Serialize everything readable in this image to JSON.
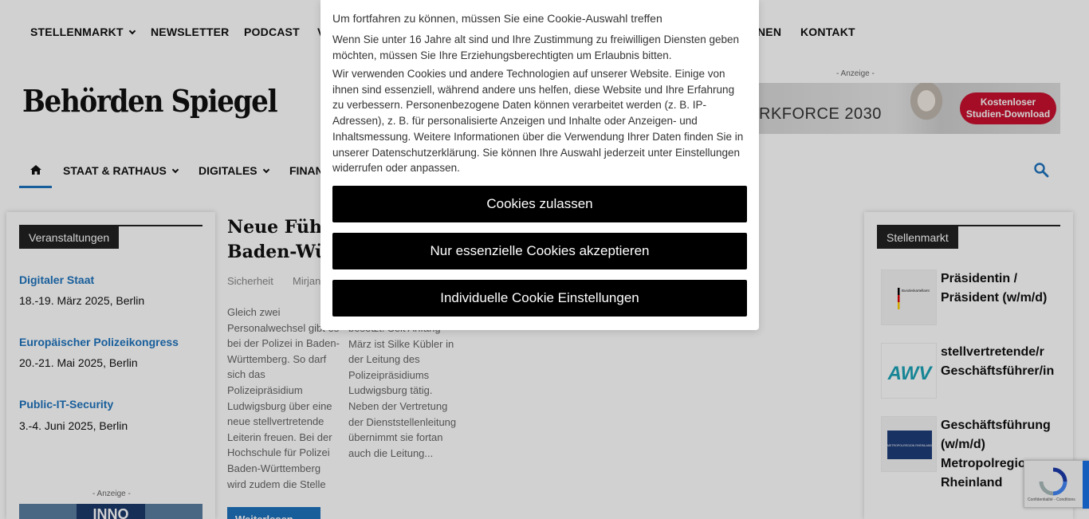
{
  "top_nav": {
    "items": [
      "STELLENMARKT",
      "NEWSLETTER",
      "PODCAST",
      "V",
      "NEN",
      "KONTAKT"
    ]
  },
  "logo": "Behörden Spiegel",
  "ads": {
    "label": "- Anzeige -",
    "banner_text": "RKFORCE 2030",
    "banner_cta_line1": "Kostenloser",
    "banner_cta_line2": "Studien-Download",
    "bottom_ad_text": "INNO"
  },
  "main_nav": {
    "items": [
      "STAAT & RATHAUS",
      "DIGITALES",
      "FINAN"
    ],
    "home_icon": "home-icon",
    "search_icon": "search-icon"
  },
  "events": {
    "heading": "Veranstaltungen",
    "items": [
      {
        "title": "Digitaler Staat",
        "date": "18.-19. März 2025, Berlin"
      },
      {
        "title": "Europäischer Polizeikongress",
        "date": "20.-21. Mai 2025, Berlin"
      },
      {
        "title": "Public-IT-Security",
        "date": "3.-4. Juni 2025, Berlin"
      }
    ]
  },
  "article": {
    "title_line1": "Neue Führ",
    "title_line2": "Baden-Wü",
    "category": "Sicherheit",
    "author": "Mirjan",
    "excerpt_col1": "Gleich zwei Personalwechsel gibt es bei der Polizei in Baden-Württemberg. So darf sich das Polizeipräsidium Ludwigsburg über eine neue stellvertretende Leiterin freuen. Bei der Hochschule für Polizei Baden-Württemberg wird zudem die Stelle",
    "excerpt_col2": "besetzt. Seit Anfang März ist Silke Kübler in der Leitung des Polizeipräsidiums Ludwigsburg tätig. Neben der Vertretung der Dienststellenleitung übernimmt sie fortan auch die Leitung...",
    "read_more": "Weiterlesen"
  },
  "jobs": {
    "heading": "Stellenmarkt",
    "items": [
      {
        "title": "Präsidentin / Präsident (w/m/d)",
        "logo": "bundesadler-logo",
        "logo_text": "Bundeskartellamt"
      },
      {
        "title": "stellvertretende/r Geschäftsführer/in",
        "logo": "awv-logo",
        "logo_text": "AWV"
      },
      {
        "title": "Geschäftsführung (w/m/d) Metropolregion Rheinland",
        "logo": "metropolregion-logo",
        "logo_text": "METROPOLREGION RHEINLAND"
      }
    ]
  },
  "recaptcha": {
    "text": "Confidentialité - Conditions"
  },
  "cookie_modal": {
    "heading": "Um fortfahren zu können, müssen Sie eine Cookie-Auswahl treffen",
    "paragraph1": "Wenn Sie unter 16 Jahre alt sind und Ihre Zustimmung zu freiwilligen Diensten geben möchten, müssen Sie Ihre Erziehungsberechtigten um Erlaubnis bitten.",
    "paragraph2": "Wir verwenden Cookies und andere Technologien auf unserer Website. Einige von ihnen sind essenziell, während andere uns helfen, diese Website und Ihre Erfahrung zu verbessern. Personenbezogene Daten können verarbeitet werden (z. B. IP-Adressen), z. B. für personalisierte Anzeigen und Inhalte oder Anzeigen- und Inhaltsmessung. Weitere Informationen über die Verwendung Ihrer Daten finden Sie in unserer Datenschutzerklärung. Sie können Ihre Auswahl jederzeit unter Einstellungen widerrufen oder anpassen.",
    "btn_accept_all": "Cookies zulassen",
    "btn_essential": "Nur essenzielle Cookies akzeptieren",
    "btn_individual": "Individuelle Cookie Einstellungen"
  },
  "colors": {
    "accent": "#1e73be",
    "dark": "#222222",
    "cta_red": "#c8102e"
  }
}
